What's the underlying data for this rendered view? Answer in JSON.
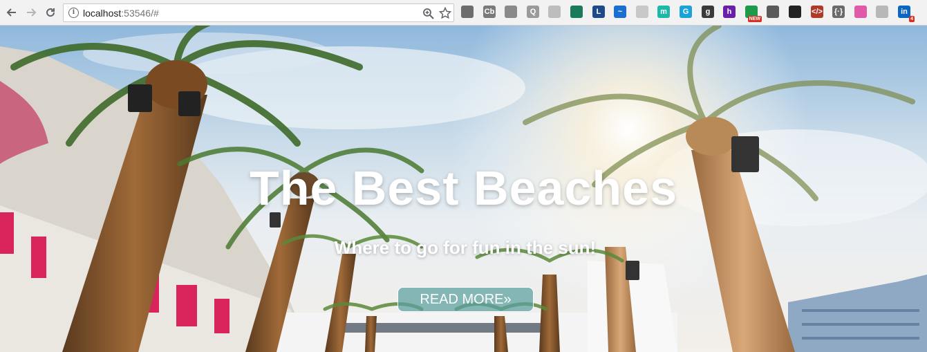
{
  "browser": {
    "url_host": "localhost",
    "url_rest": ":53546/#",
    "extensions": [
      {
        "name": "eyedropper-extension",
        "label": "",
        "color": "#6d6d6d"
      },
      {
        "name": "cb-extension",
        "label": "Cb",
        "color": "#7a7a7a"
      },
      {
        "name": "gear-extension",
        "label": "",
        "color": "#8a8a8a"
      },
      {
        "name": "q-extension",
        "label": "Q",
        "color": "#9a9a9a"
      },
      {
        "name": "grid-extension",
        "label": "",
        "color": "#bdbdbd"
      },
      {
        "name": "screenshot-extension",
        "label": "",
        "color": "#1a7a5a"
      },
      {
        "name": "l-extension",
        "label": "L",
        "color": "#1f4a8a"
      },
      {
        "name": "wave-extension",
        "label": "~",
        "color": "#1a6fd0"
      },
      {
        "name": "robot-extension",
        "label": "",
        "color": "#c8c8c8"
      },
      {
        "name": "m-extension",
        "label": "m",
        "color": "#1fb8a8"
      },
      {
        "name": "g-extension",
        "label": "G",
        "color": "#1aa3d6"
      },
      {
        "name": "g2-extension",
        "label": "g",
        "color": "#3a3a3a"
      },
      {
        "name": "h-extension",
        "label": "h",
        "color": "#6a1fa8"
      },
      {
        "name": "new-extension",
        "label": "",
        "color": "#1f9a4a",
        "badge": "NEW"
      },
      {
        "name": "puzzle-extension",
        "label": "",
        "color": "#5a5a5a"
      },
      {
        "name": "check-extension",
        "label": "",
        "color": "#222222"
      },
      {
        "name": "code-extension",
        "label": "</>",
        "color": "#b03a2a"
      },
      {
        "name": "json-extension",
        "label": "{·}",
        "color": "#6a6a6a"
      },
      {
        "name": "gradient-extension",
        "label": "",
        "color": "#e05aa8"
      },
      {
        "name": "vs-extension",
        "label": "",
        "color": "#b8b8b8"
      },
      {
        "name": "linkedin-extension",
        "label": "in",
        "color": "#0a66c2",
        "badge": "4"
      }
    ]
  },
  "hero": {
    "title": "The Best Beaches",
    "subtitle": "Where to go for fun in the sun!",
    "button_label": "READ MORE»"
  }
}
